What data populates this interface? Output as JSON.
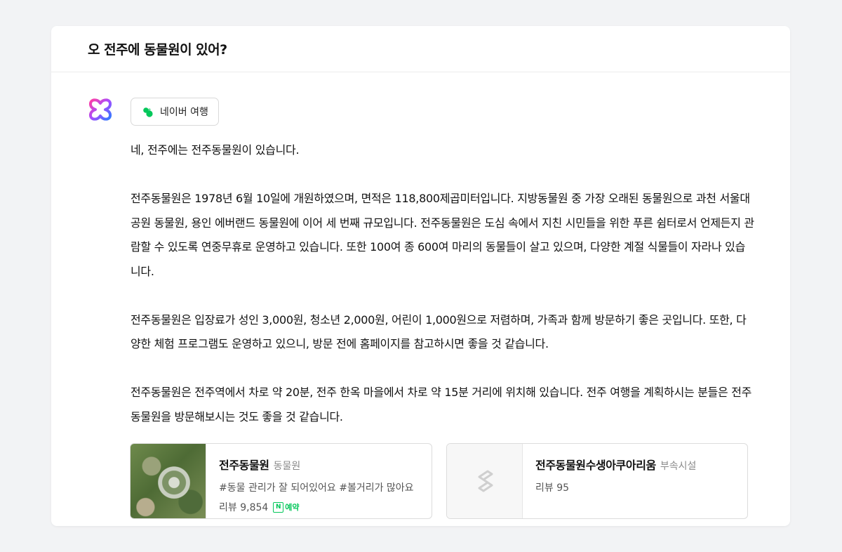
{
  "question": "오 전주에 동물원이 있어?",
  "source_chip": {
    "label": "네이버 여행",
    "icon": "naver-travel-icon",
    "icon_color": "#03c75a"
  },
  "answer_paragraphs": [
    "네, 전주에는 전주동물원이 있습니다.",
    "전주동물원은 1978년 6월 10일에 개원하였으며, 면적은 118,800제곱미터입니다. 지방동물원 중 가장 오래된 동물원으로 과천 서울대공원 동물원, 용인 에버랜드 동물원에 이어 세 번째 규모입니다. 전주동물원은 도심 속에서 지친 시민들을 위한 푸른 쉼터로서 언제든지 관람할 수 있도록 연중무휴로 운영하고 있습니다. 또한 100여 종 600여 마리의 동물들이 살고 있으며, 다양한 계절 식물들이 자라나 있습니다.",
    "전주동물원은 입장료가 성인 3,000원, 청소년 2,000원, 어린이 1,000원으로 저렴하며, 가족과 함께 방문하기 좋은 곳입니다. 또한, 다양한 체험 프로그램도 운영하고 있으니, 방문 전에 홈페이지를 참고하시면 좋을 것 같습니다.",
    "전주동물원은 전주역에서 차로 약 20분, 전주 한옥 마을에서 차로 약 15분 거리에 위치해 있습니다. 전주 여행을 계획하시는 분들은 전주동물원을 방문해보시는 것도 좋을 것 같습니다."
  ],
  "places": [
    {
      "name": "전주동물원",
      "category": "동물원",
      "tags": "#동물 관리가 잘 되어있어요 #볼거리가 많아요",
      "reviews": "리뷰 9,854",
      "reserve_label": "예약",
      "thumbnail": "aerial-zoo-photo"
    },
    {
      "name": "전주동물원수생아쿠아리움",
      "category": "부속시설",
      "reviews": "리뷰 95",
      "thumbnail": "placeholder-logo-icon"
    }
  ],
  "colors": {
    "naver_green": "#03c75a",
    "background": "#f2f3f5",
    "card": "#ffffff"
  }
}
